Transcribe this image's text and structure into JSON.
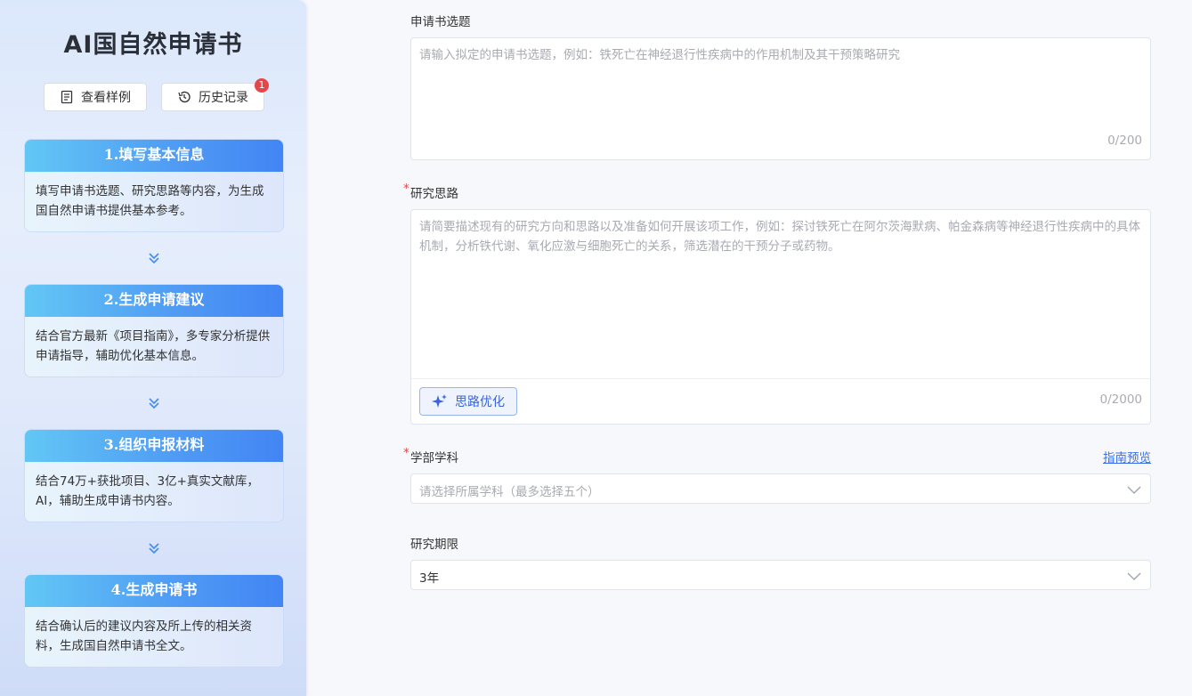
{
  "sidebar": {
    "title": "AI国自然申请书",
    "buttons": {
      "samples": "查看样例",
      "history": "历史记录",
      "history_badge": "1"
    },
    "steps": [
      {
        "title": "1.填写基本信息",
        "desc": "填写申请书选题、研究思路等内容，为生成国自然申请书提供基本参考。"
      },
      {
        "title": "2.生成申请建议",
        "desc": "结合官方最新《项目指南》，多专家分析提供申请指导，辅助优化基本信息。"
      },
      {
        "title": "3.组织申报材料",
        "desc": "结合74万+获批项目、3亿+真实文献库，AI，辅助生成申请书内容。"
      },
      {
        "title": "4.生成申请书",
        "desc": "结合确认后的建议内容及所上传的相关资料，生成国自然申请书全文。"
      }
    ]
  },
  "form": {
    "topic": {
      "label": "申请书选题",
      "placeholder": "请输入拟定的申请书选题，例如：铁死亡在神经退行性疾病中的作用机制及其干预策略研究",
      "counter": "0/200"
    },
    "idea": {
      "required_mark": "*",
      "label": "研究思路",
      "placeholder": "请简要描述现有的研究方向和思路以及准备如何开展该项工作，例如：探讨铁死亡在阿尔茨海默病、帕金森病等神经退行性疾病中的具体机制，分析铁代谢、氧化应激与细胞死亡的关系，筛选潜在的干预分子或药物。",
      "optimize_button": "思路优化",
      "counter": "0/2000"
    },
    "discipline": {
      "required_mark": "*",
      "label": "学部学科",
      "guide_link": "指南预览",
      "placeholder": "请选择所属学科（最多选择五个）"
    },
    "period": {
      "label": "研究期限",
      "value": "3年"
    }
  },
  "colors": {
    "accent": "#4285f4",
    "required": "#e64545",
    "badge": "#e6454a",
    "link": "#3a6ff0"
  }
}
